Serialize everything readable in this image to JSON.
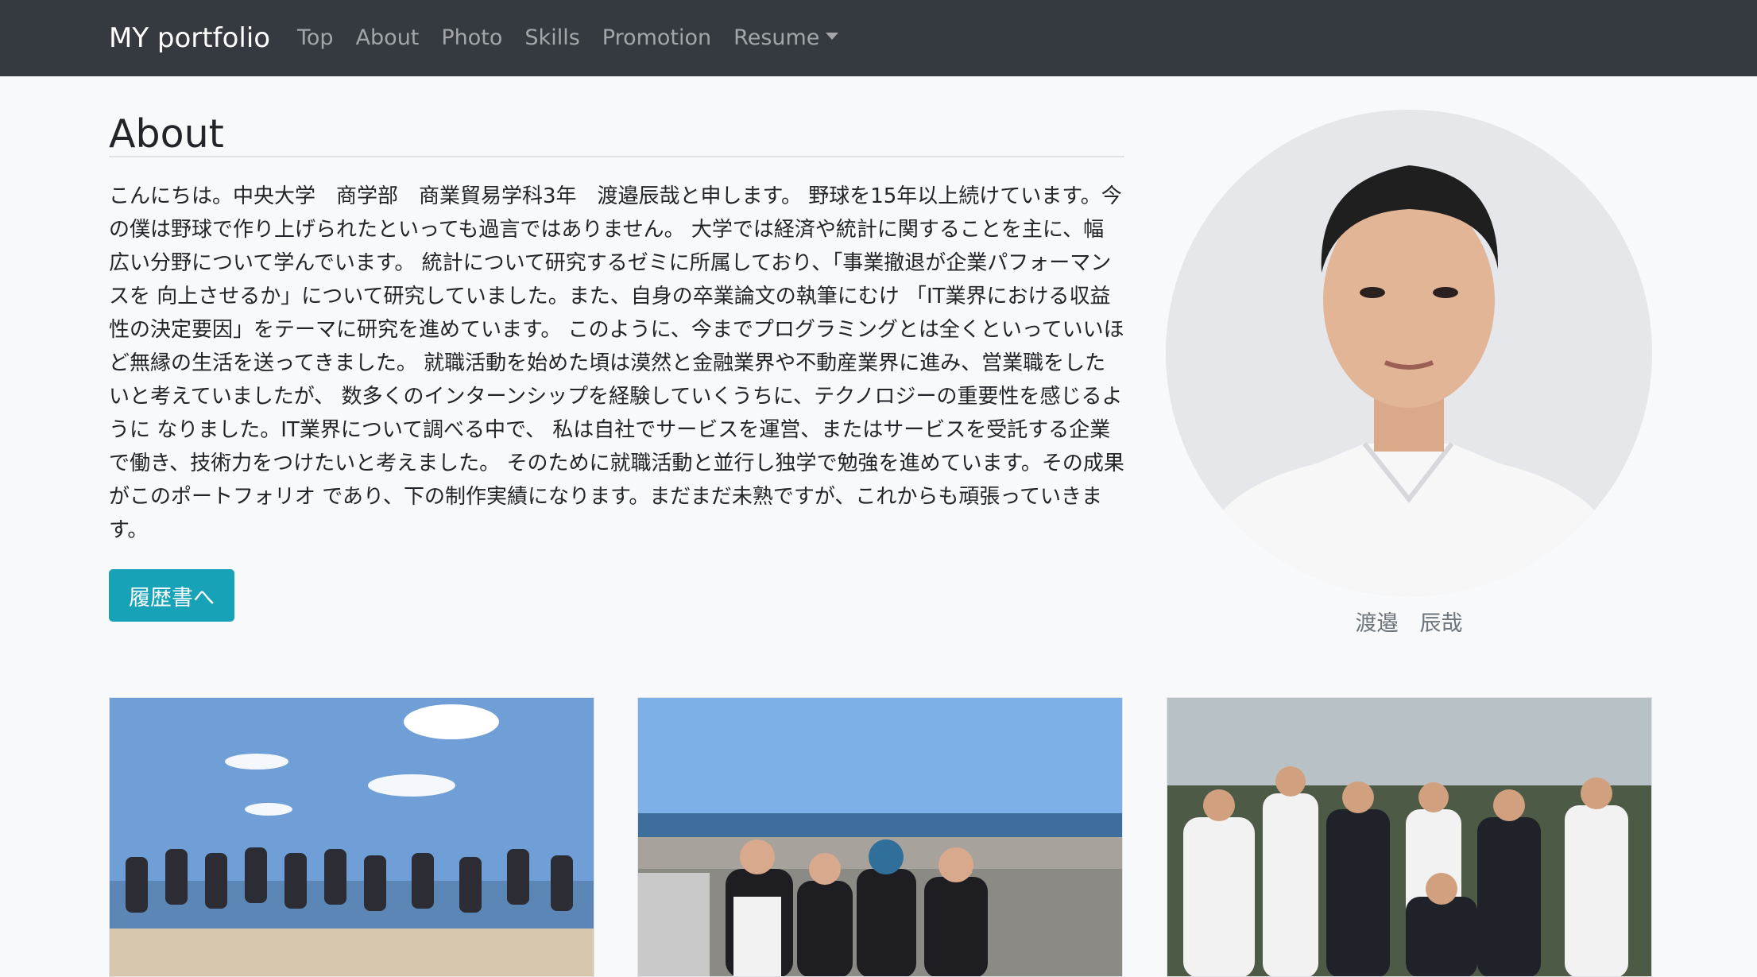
{
  "navbar": {
    "brand": "MY portfolio",
    "links": [
      "Top",
      "About",
      "Photo",
      "Skills",
      "Promotion",
      "Resume"
    ]
  },
  "about": {
    "heading": "About",
    "text": "こんにちは。中央大学　商学部　商業貿易学科3年　渡邉辰哉と申します。 野球を15年以上続けています。今の僕は野球で作り上げられたといっても過言ではありません。 大学では経済や統計に関することを主に、幅広い分野について学んでいます。 統計について研究するゼミに所属しており、「事業撤退が企業パフォーマンスを 向上させるか」について研究していました。また、自身の卒業論文の執筆にむけ 「IT業界における収益性の決定要因」をテーマに研究を進めています。 このように、今までプログラミングとは全くといっていいほど無縁の生活を送ってきました。 就職活動を始めた頃は漠然と金融業界や不動産業界に進み、営業職をしたいと考えていましたが、 数多くのインターンシップを経験していくうちに、テクノロジーの重要性を感じるように なりました。IT業界について調べる中で、 私は自社でサービスを運営、またはサービスを受託する企業で働き、技術力をつけたいと考えました。 そのために就職活動と並行し独学で勉強を進めています。その成果がこのポートフォリオ であり、下の制作実績になります。まだまだ未熟ですが、これからも頑張っていきます。",
    "button_label": "履歴書へ"
  },
  "profile": {
    "name": "渡邉　辰哉"
  },
  "colors": {
    "navbar_bg": "#343a40",
    "page_bg": "#f8f9fa",
    "button_info": "#17a2b8"
  }
}
